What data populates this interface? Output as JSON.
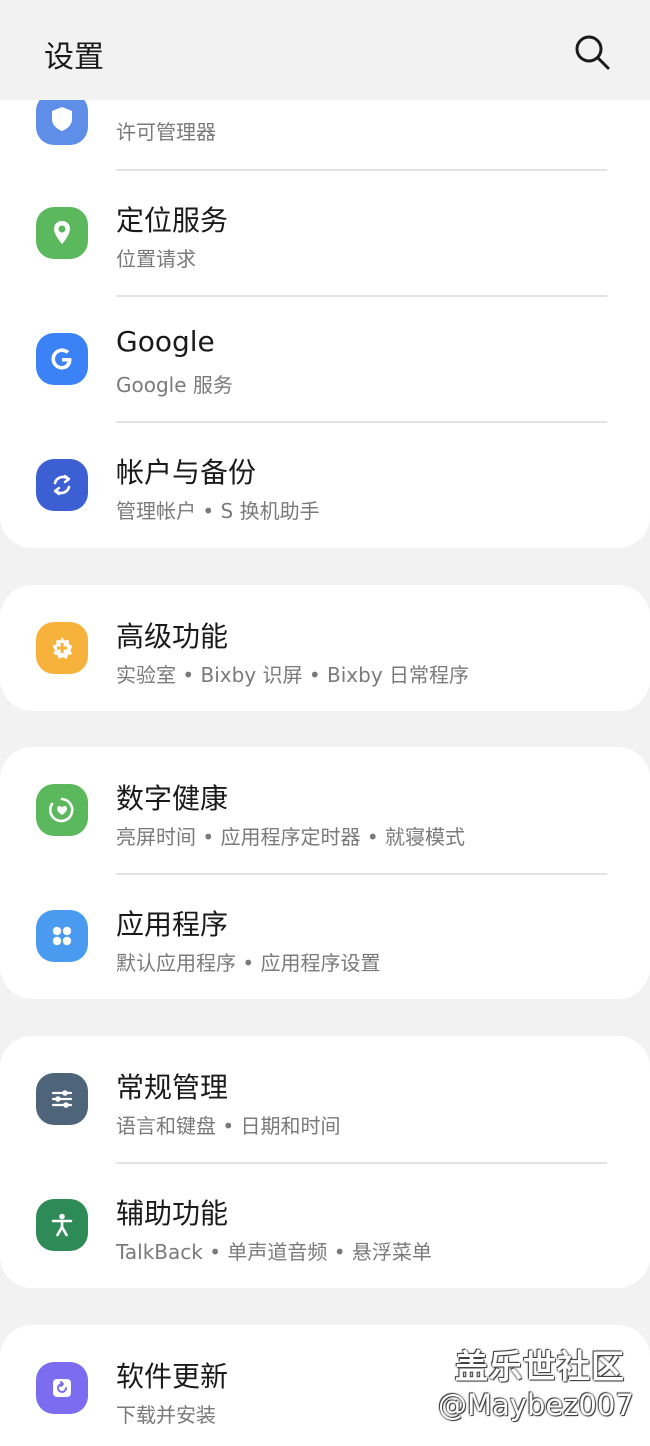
{
  "header": {
    "title": "设置",
    "search_icon": "search-icon"
  },
  "cards": [
    {
      "items": [
        {
          "title": "",
          "subtitle": "许可管理器",
          "icon": "permission-icon",
          "color": "#5f8ee8"
        },
        {
          "title": "定位服务",
          "subtitle": "位置请求",
          "icon": "location-pin-icon",
          "color": "#5cb85c"
        },
        {
          "title": "Google",
          "subtitle": "Google 服务",
          "icon": "google-g-icon",
          "color": "#3b82f6"
        },
        {
          "title": "帐户与备份",
          "subtitle": "管理帐户 • S 换机助手",
          "icon": "sync-icon",
          "color": "#3d5fd4"
        }
      ]
    },
    {
      "items": [
        {
          "title": "高级功能",
          "subtitle": "实验室 • Bixby 识屏 • Bixby 日常程序",
          "icon": "advanced-features-icon",
          "color": "#f6b23b"
        }
      ]
    },
    {
      "items": [
        {
          "title": "数字健康",
          "subtitle": "亮屏时间 • 应用程序定时器 • 就寝模式",
          "icon": "digital-wellbeing-icon",
          "color": "#5cb85c"
        },
        {
          "title": "应用程序",
          "subtitle": "默认应用程序 • 应用程序设置",
          "icon": "apps-icon",
          "color": "#4a9bef"
        }
      ]
    },
    {
      "items": [
        {
          "title": "常规管理",
          "subtitle": "语言和键盘 • 日期和时间",
          "icon": "sliders-icon",
          "color": "#4e6479"
        },
        {
          "title": "辅助功能",
          "subtitle": "TalkBack • 单声道音频 • 悬浮菜单",
          "icon": "accessibility-icon",
          "color": "#2e8b57"
        }
      ]
    },
    {
      "items": [
        {
          "title": "软件更新",
          "subtitle": "下载并安装",
          "icon": "software-update-icon",
          "color": "#7b6cf0"
        }
      ]
    }
  ],
  "watermark": {
    "line1": "盖乐世社区",
    "line2": "@Maybez007"
  }
}
